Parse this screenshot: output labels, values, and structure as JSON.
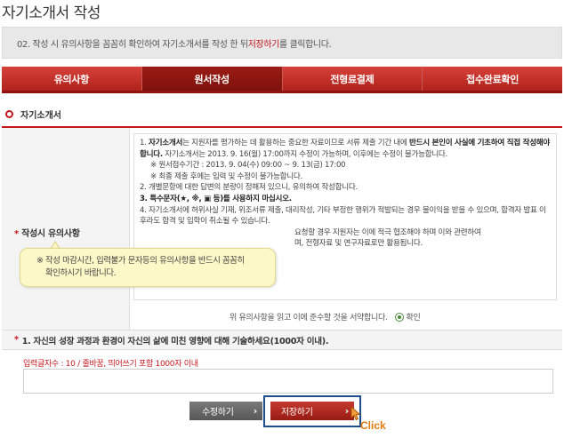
{
  "page": {
    "title": "자기소개서 작성"
  },
  "notice": {
    "prefix": "02. 작성 시 유의사항을 꼼꼼히 확인하여 자기소개서를 작성 한 뒤 ",
    "highlight": "저장하기",
    "suffix": "를 클릭합니다."
  },
  "tabs": [
    {
      "label": "유의사항",
      "active": false
    },
    {
      "label": "원서작성",
      "active": true
    },
    {
      "label": "전형료결제",
      "active": false
    },
    {
      "label": "접수완료확인",
      "active": false
    }
  ],
  "section": {
    "title": "자기소개서"
  },
  "form": {
    "required_mark": "*",
    "row_label": "작성시 유의사항",
    "rules": {
      "r1_num": "1. ",
      "r1_bold": "자기소개서",
      "r1_text": "는 지원자를 평가하는 데 활용하는 중요한 자료이므로 서류 제출 기간 내에 ",
      "r1_bold2": "반드시 본인이 사실에 기초하여 직접 작성해야 합니다.",
      "r1_text2": " 자기소개서는 2013. 9. 16(월) 17:00까지 수정이 가능하며, 이후에는 수정이 불가능합니다.",
      "r1_sub1": "※ 원서접수기간 : 2013. 9. 04(수) 09:00 ~ 9. 13(금) 17:00",
      "r1_sub2": "※ 최종 제출 후에는 입력 및 수정이 불가능합니다.",
      "r2": "2. 개별문항에 대한 답변의 분량이 정해져 있으니, 유의하여 작성합니다.",
      "r3": "3. 특수문자(★, ※, ▣ 등)를 사용하지 마십시오.",
      "r4a": "4. 자기소개서에 허위사실 기재, 위조서류 제출, 대리작성, 기타 부정한 행위가 적발되는 경우 불이익을 받을 수 있으며, 합격자 발표 이후라도 합격 및 입학이 취소될 수 있습니다.",
      "r4b": "요청할 경우 지원자는 이에 적극 협조해야 하며 이와 관련하여",
      "r4c": "며, 전형자료 및 연구자료로만 활용됩니다."
    },
    "agree_text": "위 유의사항을 읽고 이에 준수할 것을 서약합니다.",
    "agree_option": "확인",
    "question": "1. 자신의 성장 과정과 환경이 자신의 삶에 미친 영향에 대해 기술하세요(1000자 이내).",
    "char_count": "입력글자수 : 10 / 줄바꿈, 띄어쓰기 포함 1000자 이내"
  },
  "tooltip": {
    "line1": "※ 작성 마감시간, 입력불가 문자등의 유의사항을 반드시 꼼꼼히",
    "line2": "확인하시기 바랍니다."
  },
  "buttons": {
    "edit": "수정하기",
    "save": "저장하기",
    "arrow": "›"
  },
  "annotation": {
    "click": "Click"
  },
  "colors": {
    "accent_red": "#c4161c",
    "tab_red": "#b0221b",
    "highlight_frame": "#1d4f8e",
    "click_orange": "#e07a10",
    "tooltip_bg": "#fdf8c8"
  },
  "icons": {
    "cursor": "hand-pointer-icon",
    "radio": "radio-checked-icon",
    "bullet": "circle-bullet-icon"
  }
}
